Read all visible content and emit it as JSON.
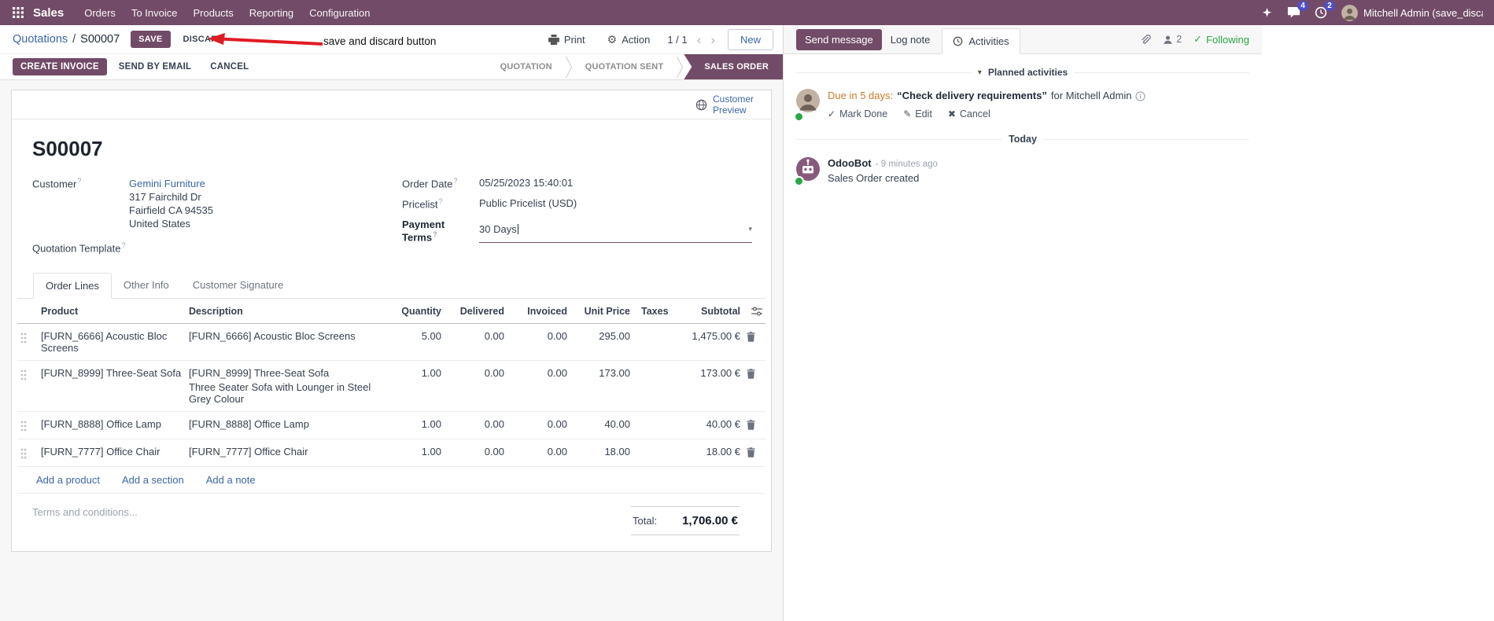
{
  "icons": {
    "caret_down": "▾",
    "chevron_left": "‹",
    "chevron_right": "›",
    "check": "✓",
    "pencil": "✎",
    "cross": "✖",
    "gear": "⚙",
    "slash": "/"
  },
  "topbar": {
    "app_name": "Sales",
    "menus": [
      "Orders",
      "To Invoice",
      "Products",
      "Reporting",
      "Configuration"
    ],
    "messages_badge": "4",
    "activities_badge": "2",
    "user_name": "Mitchell Admin (save_discar"
  },
  "breadcrumb": {
    "parent": "Quotations",
    "current": "S00007",
    "save_label": "SAVE",
    "discard_label": "DISCARD",
    "print_label": "Print",
    "action_label": "Action",
    "pager": "1 / 1",
    "new_label": "New"
  },
  "annotation": {
    "text": "save and discard button"
  },
  "statusbar": {
    "create_invoice": "CREATE INVOICE",
    "send_by_email": "SEND BY EMAIL",
    "cancel": "CANCEL",
    "states": [
      "QUOTATION",
      "QUOTATION SENT",
      "SALES ORDER"
    ],
    "active_state": "SALES ORDER"
  },
  "sheet": {
    "customer_preview": "Customer Preview",
    "title": "S00007",
    "help_marker": "?",
    "fields": {
      "customer_label": "Customer",
      "customer_name": "Gemini Furniture",
      "address_line1": "317 Fairchild Dr",
      "address_line2": "Fairfield CA 94535",
      "address_line3": "United States",
      "order_date_label": "Order Date",
      "order_date": "05/25/2023 15:40:01",
      "pricelist_label": "Pricelist",
      "pricelist": "Public Pricelist (USD)",
      "payment_terms_label": "Payment Terms",
      "payment_terms": "30 Days",
      "quotation_template_label": "Quotation Template"
    },
    "tabs": [
      "Order Lines",
      "Other Info",
      "Customer Signature"
    ],
    "table": {
      "headers": [
        "Product",
        "Description",
        "Quantity",
        "Delivered",
        "Invoiced",
        "Unit Price",
        "Taxes",
        "Subtotal"
      ],
      "rows": [
        {
          "product": "[FURN_6666] Acoustic Bloc Screens",
          "description": "[FURN_6666] Acoustic Bloc Screens",
          "description2": "",
          "quantity": "5.00",
          "delivered": "0.00",
          "invoiced": "0.00",
          "unit_price": "295.00",
          "taxes": "",
          "subtotal": "1,475.00 €"
        },
        {
          "product": "[FURN_8999] Three-Seat Sofa",
          "description": "[FURN_8999] Three-Seat Sofa",
          "description2": "Three Seater Sofa with Lounger in Steel Grey Colour",
          "quantity": "1.00",
          "delivered": "0.00",
          "invoiced": "0.00",
          "unit_price": "173.00",
          "taxes": "",
          "subtotal": "173.00 €"
        },
        {
          "product": "[FURN_8888] Office Lamp",
          "description": "[FURN_8888] Office Lamp",
          "description2": "",
          "quantity": "1.00",
          "delivered": "0.00",
          "invoiced": "0.00",
          "unit_price": "40.00",
          "taxes": "",
          "subtotal": "40.00 €"
        },
        {
          "product": "[FURN_7777] Office Chair",
          "description": "[FURN_7777] Office Chair",
          "description2": "",
          "quantity": "1.00",
          "delivered": "0.00",
          "invoiced": "0.00",
          "unit_price": "18.00",
          "taxes": "",
          "subtotal": "18.00 €"
        }
      ],
      "footer_links": [
        "Add a product",
        "Add a section",
        "Add a note"
      ]
    },
    "terms_placeholder": "Terms and conditions...",
    "total_label": "Total:",
    "total_value": "1,706.00 €"
  },
  "chatter": {
    "send_message": "Send message",
    "log_note": "Log note",
    "activities_tab": "Activities",
    "followers_count": "2",
    "following": "Following",
    "planned_header": "Planned activities",
    "activity": {
      "due": "Due in 5 days:",
      "summary": "“Check delivery requirements”",
      "for_text": "for Mitchell Admin",
      "mark_done": "Mark Done",
      "edit": "Edit",
      "cancel": "Cancel"
    },
    "today": "Today",
    "message": {
      "author": "OdooBot",
      "time": "- 9 minutes ago",
      "body": "Sales Order created"
    }
  }
}
